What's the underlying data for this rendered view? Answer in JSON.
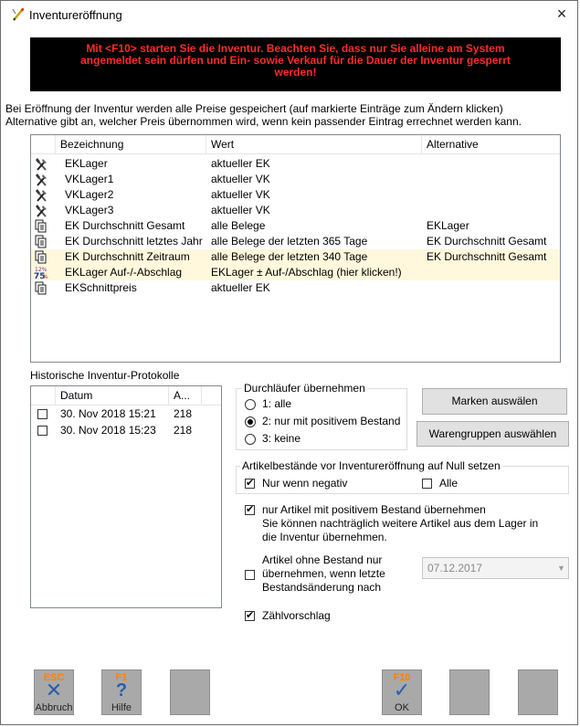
{
  "window": {
    "title": "Inventureröffnung",
    "close_glyph": "×",
    "icon": "pencil-icon"
  },
  "warning": {
    "line1": "Mit <F10> starten Sie die Inventur. Beachten Sie, dass nur Sie alleine am System",
    "line2": "angemeldet sein dürfen und Ein- sowie Verkauf für die Dauer der Inventur gesperrt",
    "line3": "werden!",
    "bg_color": "#000000",
    "text_color": "#ff2a2a"
  },
  "info": {
    "line1": "Bei Eröffnung der Inventur werden alle Preise gespeichert (auf markierte Einträge zum Ändern klicken)",
    "line2": "Alternative gibt an, welcher Preis übernommen wird, wenn kein passender Eintrag errechnet werden kann."
  },
  "price_table": {
    "columns": [
      "Bezeichnung",
      "Wert",
      "Alternative"
    ],
    "rows": [
      {
        "icon": "tools-icon",
        "bezeichnung": "EKLager",
        "wert": "aktueller EK",
        "alternative": "",
        "highlight": false
      },
      {
        "icon": "tools-icon",
        "bezeichnung": "VKLager1",
        "wert": "aktueller VK",
        "alternative": "",
        "highlight": false
      },
      {
        "icon": "tools-icon",
        "bezeichnung": "VKLager2",
        "wert": "aktueller VK",
        "alternative": "",
        "highlight": false
      },
      {
        "icon": "tools-icon",
        "bezeichnung": "VKLager3",
        "wert": "aktueller VK",
        "alternative": "",
        "highlight": false
      },
      {
        "icon": "documents-icon",
        "bezeichnung": "EK Durchschnitt Gesamt",
        "wert": "alle Belege",
        "alternative": "EKLager",
        "highlight": false
      },
      {
        "icon": "documents-icon",
        "bezeichnung": "EK Durchschnitt letztes Jahr",
        "wert": "alle Belege der letzten 365 Tage",
        "alternative": "EK Durchschnitt Gesamt",
        "highlight": false
      },
      {
        "icon": "documents-icon",
        "bezeichnung": "EK Durchschnitt Zeitraum",
        "wert": "alle Belege der letzten 340 Tage",
        "alternative": "EK Durchschnitt Gesamt",
        "highlight": true
      },
      {
        "icon": "percent-icon",
        "bezeichnung": "EKLager Auf-/-Abschlag",
        "wert": "EKLager ± Auf-/Abschlag (hier klicken!)",
        "alternative": "",
        "highlight": true
      },
      {
        "icon": "documents-icon",
        "bezeichnung": "EKSchnittpreis",
        "wert": "aktueller EK",
        "alternative": "",
        "highlight": false
      }
    ]
  },
  "protocols": {
    "label": "Historische Inventur-Protokolle",
    "columns": [
      "Datum",
      "A..."
    ],
    "rows": [
      {
        "datum": "30. Nov 2018 15:21",
        "a": "218",
        "checked": false
      },
      {
        "datum": "30. Nov 2018 15:23",
        "a": "218",
        "checked": false
      }
    ]
  },
  "durchlaeufer": {
    "title": "Durchläufer übernehmen",
    "options": [
      {
        "label": "1: alle",
        "selected": false
      },
      {
        "label": "2: nur mit positivem Bestand",
        "selected": true
      },
      {
        "label": "3: keine",
        "selected": false
      }
    ]
  },
  "buttons": {
    "marken": "Marken auswälen",
    "warengruppen": "Warengruppen auswählen"
  },
  "null_setzen": {
    "title": "Artikelbestände vor Inventureröffnung auf Null setzen",
    "nur_negativ": {
      "label": "Nur wenn negativ",
      "checked": true
    },
    "alle": {
      "label": "Alle",
      "checked": false
    }
  },
  "positiv": {
    "checked": true,
    "line1": "nur Artikel mit positivem Bestand übernehmen",
    "line2": "Sie können nachträglich weitere Artikel aus dem Lager in",
    "line3": "die Inventur übernehmen."
  },
  "ohne_bestand": {
    "checked": false,
    "line1": "Artikel ohne Bestand nur",
    "line2": "übernehmen, wenn letzte",
    "line3": "Bestandsänderung nach",
    "date_value": "07.12.2017"
  },
  "zaehlvorschlag": {
    "label": "Zählvorschlag",
    "checked": true
  },
  "fkeys": {
    "esc": {
      "code": "ESC",
      "label": "Abbruch",
      "icon": "x-icon"
    },
    "f1": {
      "code": "F1",
      "label": "Hilfe",
      "icon": "question-icon"
    },
    "f10": {
      "code": "F10",
      "label": "OK",
      "icon": "checkmark-icon"
    }
  }
}
